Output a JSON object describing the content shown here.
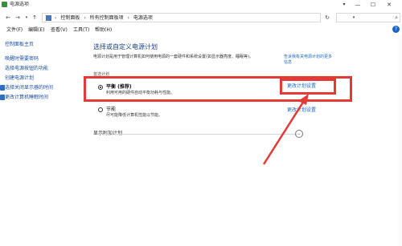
{
  "window": {
    "title": "电源选项",
    "minimize": "—",
    "maximize": "☐",
    "close": "✕",
    "pin": "▾",
    "accent_color": "#e53935"
  },
  "address": {
    "crumbs": [
      "控制面板",
      "所有控制面板项",
      "电源选项"
    ],
    "separator": "›",
    "dropdown": "▾",
    "refresh": "↻",
    "search_placeholder": "",
    "search_icon": "⌕"
  },
  "nav": {
    "back": "←",
    "forward": "→",
    "recent": "▾",
    "up": "↑"
  },
  "menu": {
    "items": [
      "文件(F)",
      "编辑(E)",
      "查看(V)",
      "工具(T)",
      "帮助(H)"
    ],
    "help": "?"
  },
  "sidebar": {
    "items": [
      "控制面板主页",
      "唤醒时需要密码",
      "选择电源按钮的功能",
      "创建电源计划",
      "选择关闭显示器的时间",
      "更改计算机睡眠时间"
    ]
  },
  "main": {
    "heading": "选择或自定义电源计划",
    "intro": "电源计划是用于管理计算机如何使用电源的一套硬件和系统设置(如显示器亮度、睡眠等)。",
    "intro_link": "告诉我有关电源计划的更多信息",
    "plans_label": "首选计划",
    "plans": [
      {
        "name": "平衡 (推荐)",
        "desc": "利用可用的硬件自动平衡功耗与性能。",
        "link": "更改计划设置",
        "selected": true
      },
      {
        "name": "节能",
        "desc": "尽可能降低计算机性能以节能。",
        "link": "更改计划设置",
        "selected": false
      }
    ],
    "show_more": "显示附加计划",
    "expand": "⌄"
  }
}
